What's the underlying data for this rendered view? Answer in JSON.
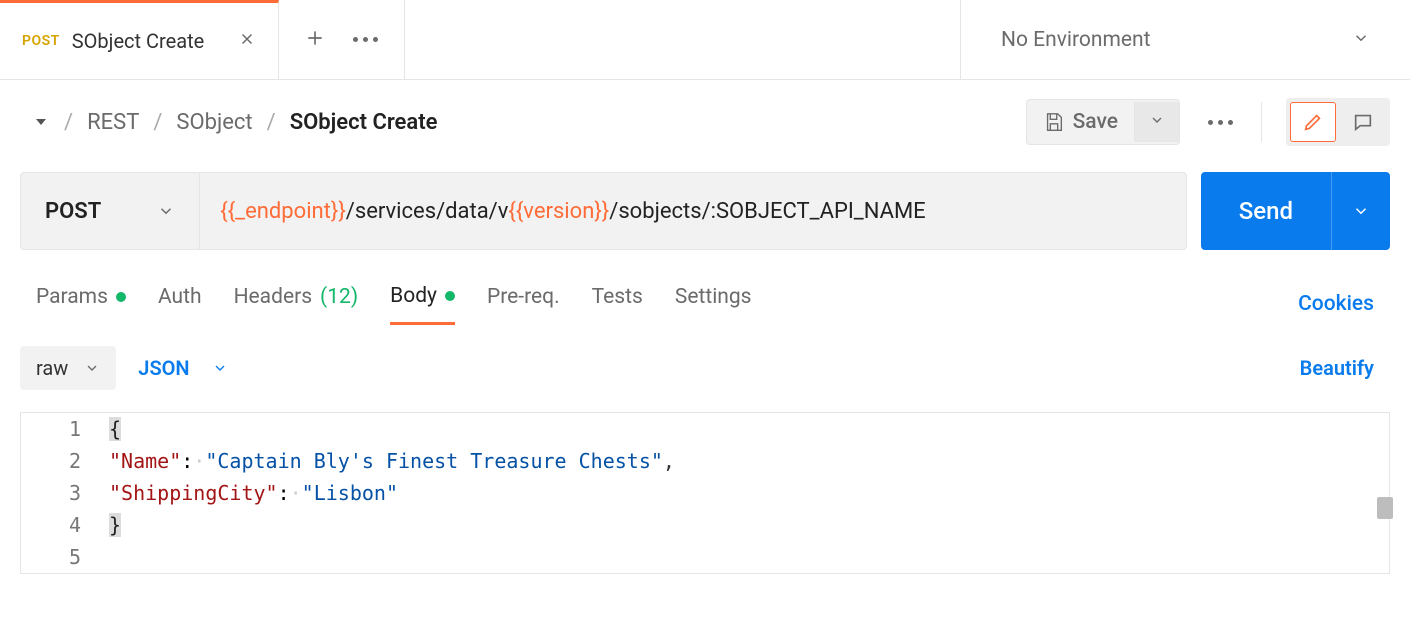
{
  "tab": {
    "method": "POST",
    "title": "SObject Create"
  },
  "environment": "No Environment",
  "breadcrumb": {
    "p1": "REST",
    "p2": "SObject",
    "current": "SObject Create"
  },
  "save_label": "Save",
  "request": {
    "method": "POST",
    "url": {
      "v1": "{{_endpoint}}",
      "t1": "/services/data/v",
      "v2": "{{version}}",
      "t2": "/sobjects/:SOBJECT_API_NAME"
    }
  },
  "send_label": "Send",
  "tabs": {
    "params": "Params",
    "auth": "Auth",
    "headers": "Headers",
    "headers_count": "(12)",
    "body": "Body",
    "prereq": "Pre-req.",
    "tests": "Tests",
    "settings": "Settings",
    "cookies": "Cookies"
  },
  "body_opts": {
    "raw": "raw",
    "json": "JSON",
    "beautify": "Beautify"
  },
  "editor": {
    "lines": [
      "1",
      "2",
      "3",
      "4",
      "5"
    ],
    "l1": "{",
    "l2_key": "\"Name\"",
    "l2_val": "\"Captain Bly's Finest Treasure Chests\"",
    "l3_key": "\"ShippingCity\"",
    "l3_val": "\"Lisbon\"",
    "l4": "}"
  }
}
